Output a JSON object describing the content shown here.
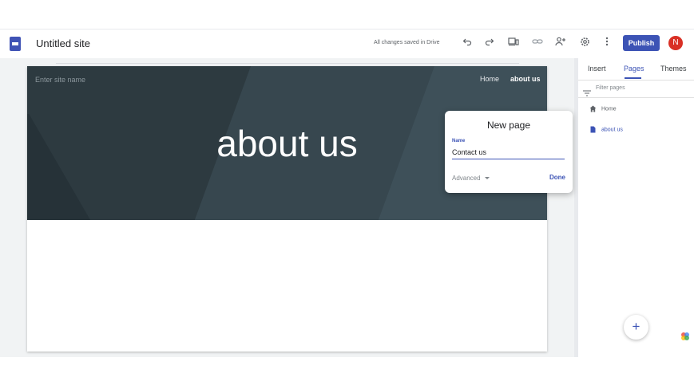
{
  "header": {
    "title": "Untitled site",
    "save_status": "All changes saved in Drive",
    "publish_label": "Publish",
    "avatar_initial": "N"
  },
  "site": {
    "name_placeholder": "Enter site name",
    "nav": [
      "Home",
      "about us"
    ],
    "hero_title": "about us"
  },
  "dialog": {
    "title": "New page",
    "name_label": "Name",
    "name_value": "Contact us",
    "advanced_label": "Advanced",
    "done_label": "Done"
  },
  "panel": {
    "tabs": [
      "Insert",
      "Pages",
      "Themes"
    ],
    "active_tab": "Pages",
    "filter_placeholder": "Filter pages",
    "pages": [
      "Home",
      "about us"
    ]
  },
  "colors": {
    "accent": "#3c53b5",
    "avatar": "#d93025",
    "hero": "#37474f"
  }
}
